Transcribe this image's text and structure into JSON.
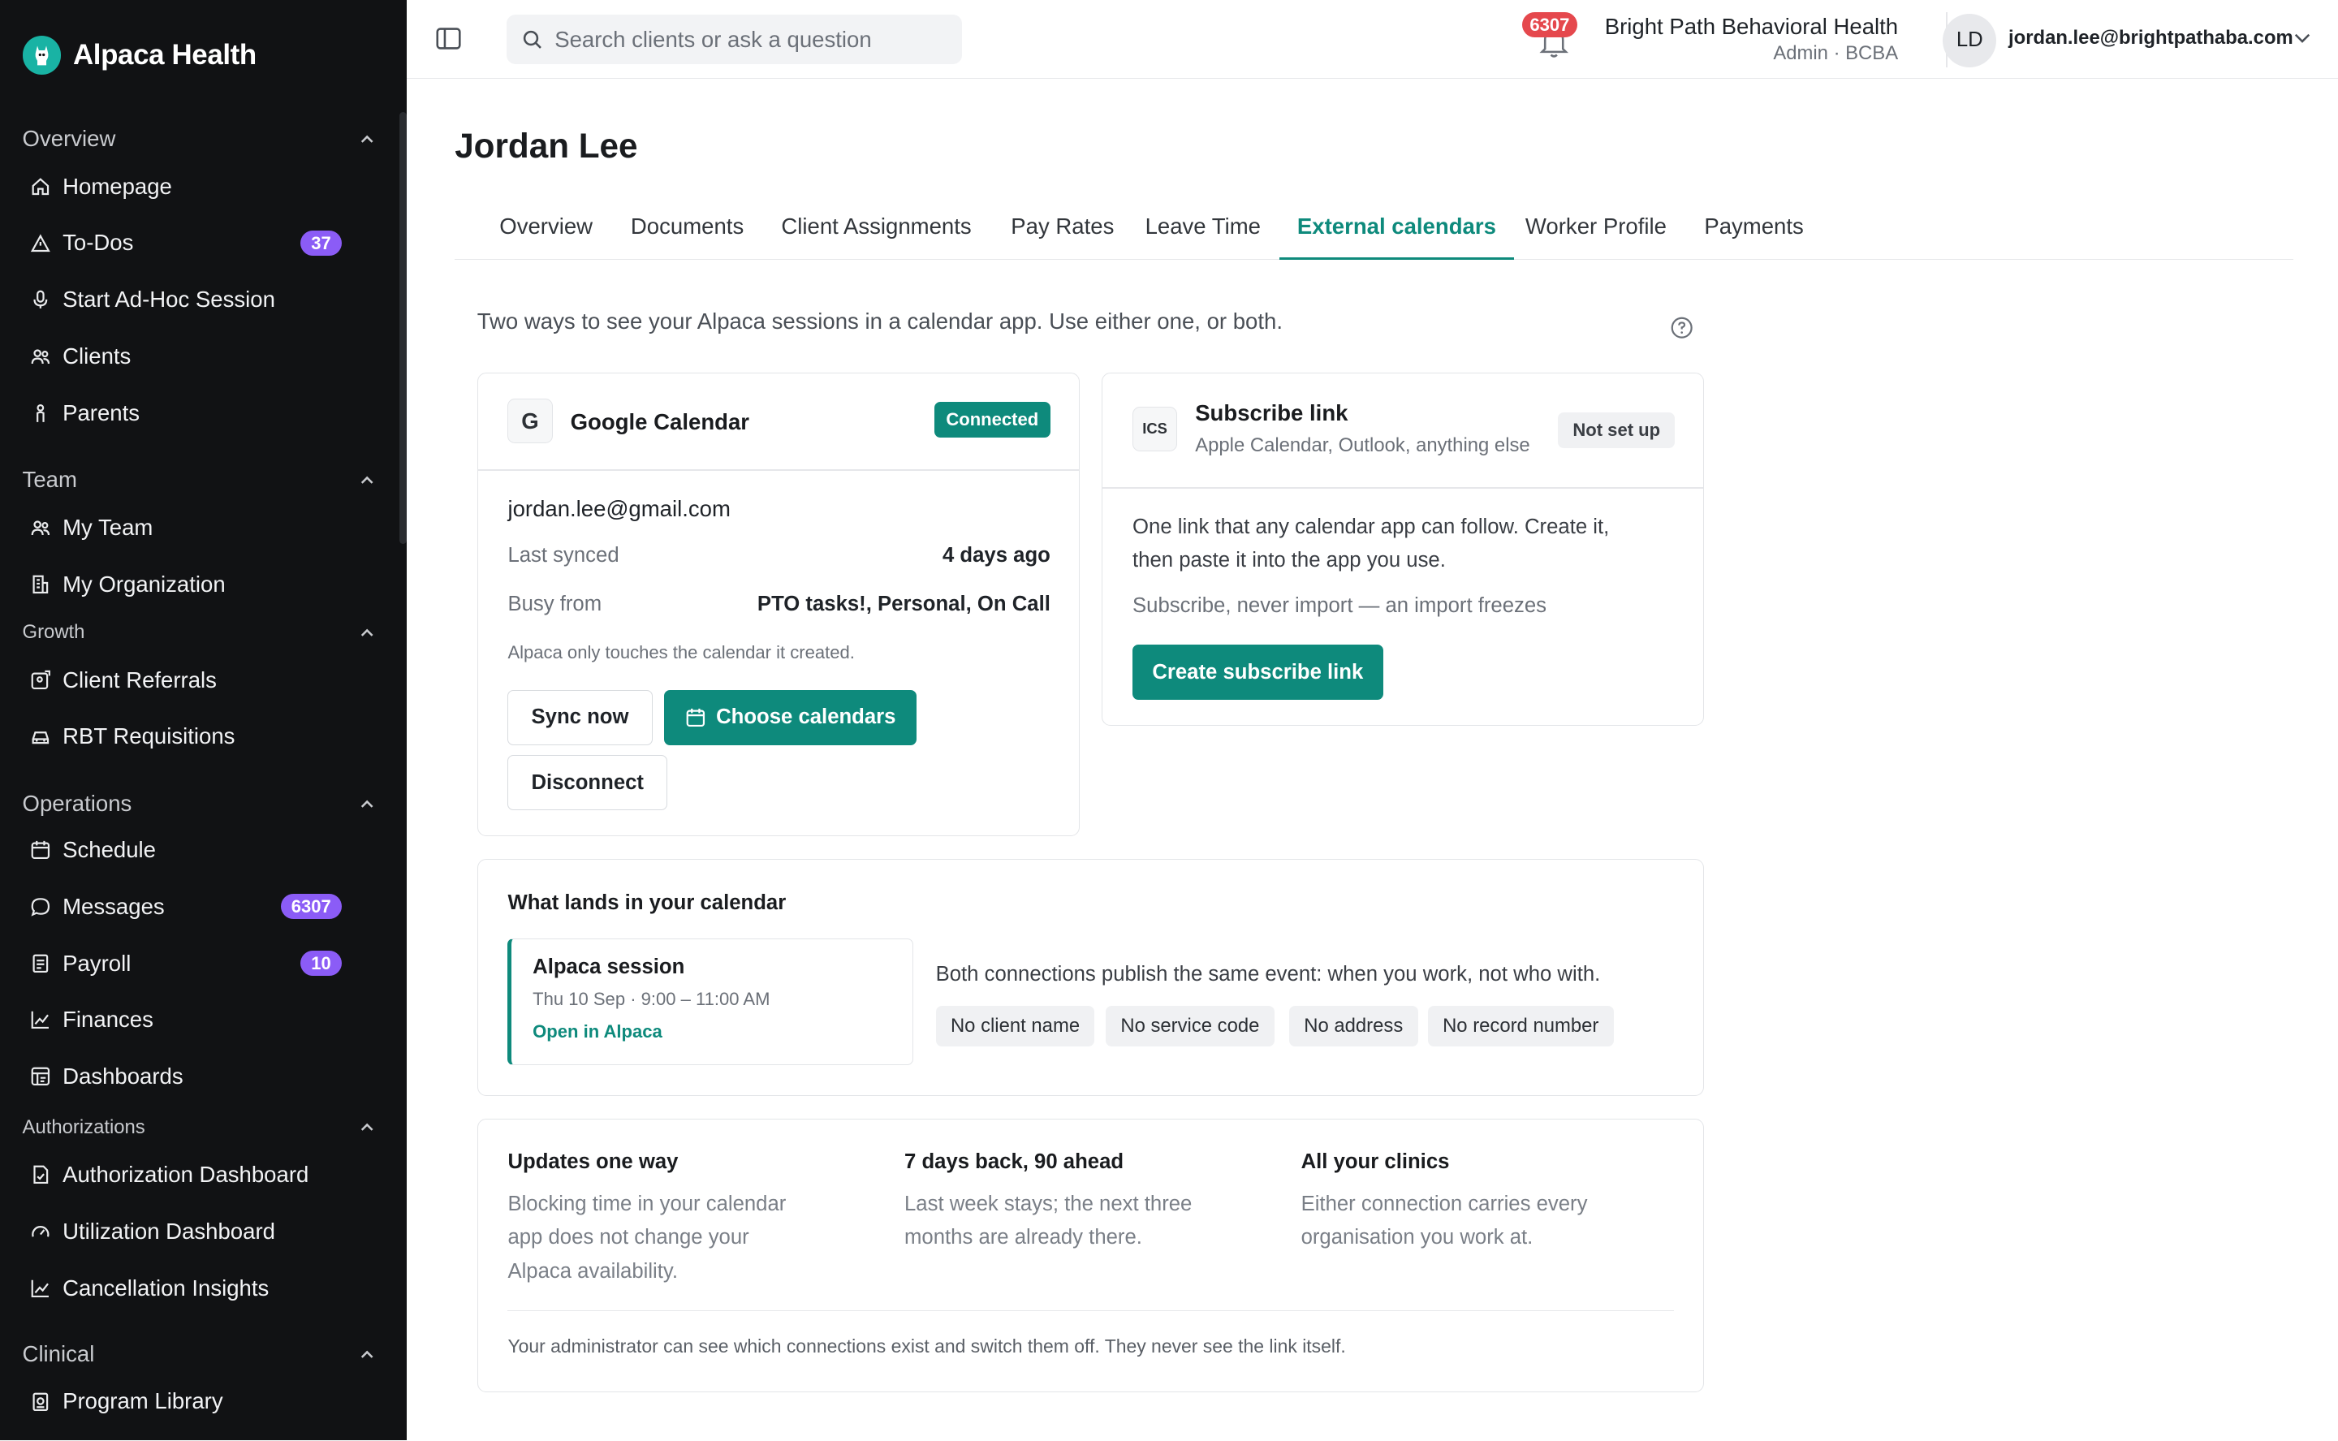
{
  "app": {
    "name": "Alpaca Health"
  },
  "sidebar": {
    "sections": [
      {
        "label": "Overview"
      },
      {
        "label": "Team"
      },
      {
        "label": "Growth"
      },
      {
        "label": "Operations"
      },
      {
        "label": "Authorizations"
      },
      {
        "label": "Clinical"
      }
    ],
    "items": [
      {
        "label": "Homepage",
        "icon": "home-icon"
      },
      {
        "label": "To-Dos",
        "icon": "warning-icon",
        "badge": "37"
      },
      {
        "label": "Start Ad-Hoc Session",
        "icon": "microphone-icon"
      },
      {
        "label": "Clients",
        "icon": "users-icon"
      },
      {
        "label": "Parents",
        "icon": "person-icon"
      },
      {
        "label": "My Team",
        "icon": "team-icon"
      },
      {
        "label": "My Organization",
        "icon": "building-icon"
      },
      {
        "label": "Client Referrals",
        "icon": "referral-icon"
      },
      {
        "label": "RBT Requisitions",
        "icon": "car-icon"
      },
      {
        "label": "Schedule",
        "icon": "calendar-icon"
      },
      {
        "label": "Messages",
        "icon": "message-icon",
        "badge": "6307"
      },
      {
        "label": "Payroll",
        "icon": "payroll-icon",
        "badge": "10"
      },
      {
        "label": "Finances",
        "icon": "chart-line-icon"
      },
      {
        "label": "Dashboards",
        "icon": "dashboard-icon"
      },
      {
        "label": "Authorization Dashboard",
        "icon": "file-check-icon"
      },
      {
        "label": "Utilization Dashboard",
        "icon": "gauge-icon"
      },
      {
        "label": "Cancellation Insights",
        "icon": "chart-line-icon"
      },
      {
        "label": "Program Library",
        "icon": "library-icon"
      }
    ]
  },
  "topbar": {
    "search_placeholder": "Search clients or ask a question",
    "notification_count": "6307",
    "org_name": "Bright Path Behavioral Health",
    "org_role": "Admin · BCBA",
    "avatar_initials": "LD",
    "user_email": "jordan.lee@brightpathaba.com"
  },
  "page": {
    "title": "Jordan Lee",
    "tabs": [
      {
        "label": "Overview"
      },
      {
        "label": "Documents"
      },
      {
        "label": "Client Assignments"
      },
      {
        "label": "Pay Rates"
      },
      {
        "label": "Leave Time"
      },
      {
        "label": "External calendars",
        "active": true
      },
      {
        "label": "Worker Profile"
      },
      {
        "label": "Payments"
      }
    ],
    "intro": "Two ways to see your Alpaca sessions in a calendar app. Use either one, or both."
  },
  "google": {
    "logo_letter": "G",
    "title": "Google Calendar",
    "status": "Connected",
    "email": "jordan.lee@gmail.com",
    "last_synced_label": "Last synced",
    "last_synced_value": "4 days ago",
    "busy_from_label": "Busy from",
    "busy_from_value": "PTO tasks!, Personal, On Call",
    "note": "Alpaca only touches the calendar it created.",
    "sync_button": "Sync now",
    "choose_button": "Choose calendars",
    "disconnect_button": "Disconnect"
  },
  "subscribe": {
    "logo_text": "ICS",
    "title": "Subscribe link",
    "subtitle": "Apple Calendar, Outlook, anything else",
    "status": "Not set up",
    "line1": "One link that any calendar app can follow. Create it,",
    "line2": "then paste it into the app you use.",
    "hint": "Subscribe, never import — an import freezes",
    "button": "Create subscribe link"
  },
  "event_preview": {
    "heading": "What lands in your calendar",
    "event_title": "Alpaca session",
    "event_time": "Thu 10 Sep · 9:00 – 11:00 AM",
    "event_link": "Open in Alpaca",
    "description": "Both connections publish the same event: when you work, not who with.",
    "chips": [
      "No client name",
      "No service code",
      "No address",
      "No record number"
    ]
  },
  "facts": [
    {
      "title": "Updates one way",
      "lines": [
        "Blocking time in your calendar",
        "app does not change your",
        "Alpaca availability."
      ]
    },
    {
      "title": "7 days back, 90 ahead",
      "lines": [
        "Last week stays; the next three",
        "months are already there."
      ]
    },
    {
      "title": "All your clinics",
      "lines": [
        "Either connection carries every",
        "organisation you work at."
      ]
    }
  ],
  "footer_note": "Your administrator can see which connections exist and switch them off. They never see the link itself.",
  "colors": {
    "accent": "#0e8a7c",
    "sidebar_bg": "#111214",
    "badge_purple": "#8b5cf6",
    "alert_red": "#e5484d"
  }
}
